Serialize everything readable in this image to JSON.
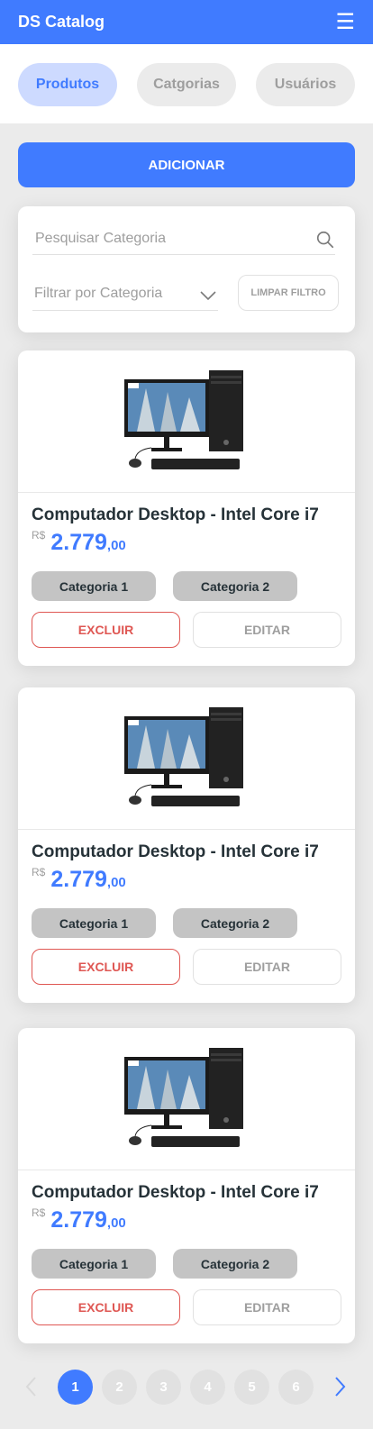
{
  "navbar": {
    "brand": "DS Catalog",
    "menu_icon": "menu-icon"
  },
  "tabs": [
    {
      "label": "Produtos",
      "active": true
    },
    {
      "label": "Catgorias",
      "active": false
    },
    {
      "label": "Usuários",
      "active": false
    }
  ],
  "add_button": {
    "label": "ADICIONAR"
  },
  "filters": {
    "search_placeholder": "Pesquisar Categoria",
    "search_icon": "search-icon",
    "category_select_placeholder": "Filtrar por Categoria",
    "clear_label": "LIMPAR FILTRO"
  },
  "products": [
    {
      "name": "Computador Desktop - Intel Core i7",
      "currency": "R$",
      "price_int": "2.779",
      "price_dec": ",00",
      "categories": [
        "Categoria 1",
        "Categoria 2"
      ],
      "delete_label": "EXCLUIR",
      "edit_label": "EDITAR"
    },
    {
      "name": "Computador Desktop - Intel Core i7",
      "currency": "R$",
      "price_int": "2.779",
      "price_dec": ",00",
      "categories": [
        "Categoria 1",
        "Categoria 2"
      ],
      "delete_label": "EXCLUIR",
      "edit_label": "EDITAR"
    },
    {
      "name": "Computador Desktop - Intel Core i7",
      "currency": "R$",
      "price_int": "2.779",
      "price_dec": ",00",
      "categories": [
        "Categoria 1",
        "Categoria 2"
      ],
      "delete_label": "EXCLUIR",
      "edit_label": "EDITAR"
    }
  ],
  "pagination": {
    "pages": [
      "1",
      "2",
      "3",
      "4",
      "5",
      "6"
    ],
    "current": "1"
  },
  "colors": {
    "primary": "#407bff",
    "primary_light": "#cddaff",
    "danger": "#df5753",
    "badge": "#c4c4c4",
    "text_dark": "#263238",
    "text_muted": "#9e9e9e",
    "background": "#ebebeb"
  }
}
